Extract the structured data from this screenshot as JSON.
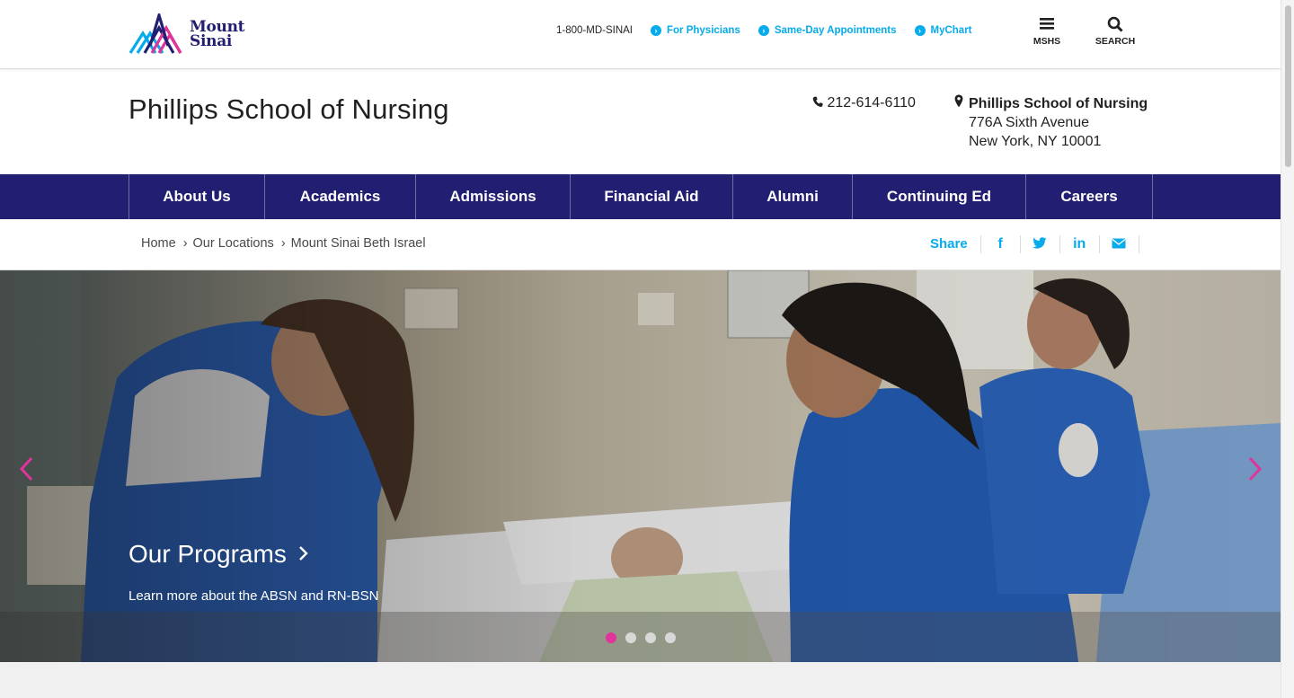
{
  "topbar": {
    "logo_line1": "Mount",
    "logo_line2": "Sinai",
    "phone": "1-800-MD-SINAI",
    "links": [
      "For Physicians",
      "Same-Day Appointments",
      "MyChart"
    ],
    "menu_label": "MSHS",
    "search_label": "SEARCH"
  },
  "header": {
    "title": "Phillips School of Nursing",
    "phone": "212-614-6110",
    "address_name": "Phillips School of Nursing",
    "address_line1": "776A Sixth Avenue",
    "address_line2": "New York, NY 10001"
  },
  "nav": {
    "items": [
      "About Us",
      "Academics",
      "Admissions",
      "Financial Aid",
      "Alumni",
      "Continuing Ed",
      "Careers"
    ]
  },
  "breadcrumb": {
    "items": [
      "Home",
      "Our Locations",
      "Mount Sinai Beth Israel"
    ]
  },
  "share": {
    "label": "Share",
    "icons": [
      "facebook-icon",
      "twitter-icon",
      "linkedin-icon",
      "email-icon"
    ]
  },
  "hero": {
    "title": "Our Programs",
    "subtitle": "Learn more about the ABSN and RN-BSN",
    "slide_count": 4,
    "active_slide": 1
  },
  "colors": {
    "brand_navy": "#221f72",
    "accent_cyan": "#06abeb",
    "accent_magenta": "#e0349a"
  }
}
